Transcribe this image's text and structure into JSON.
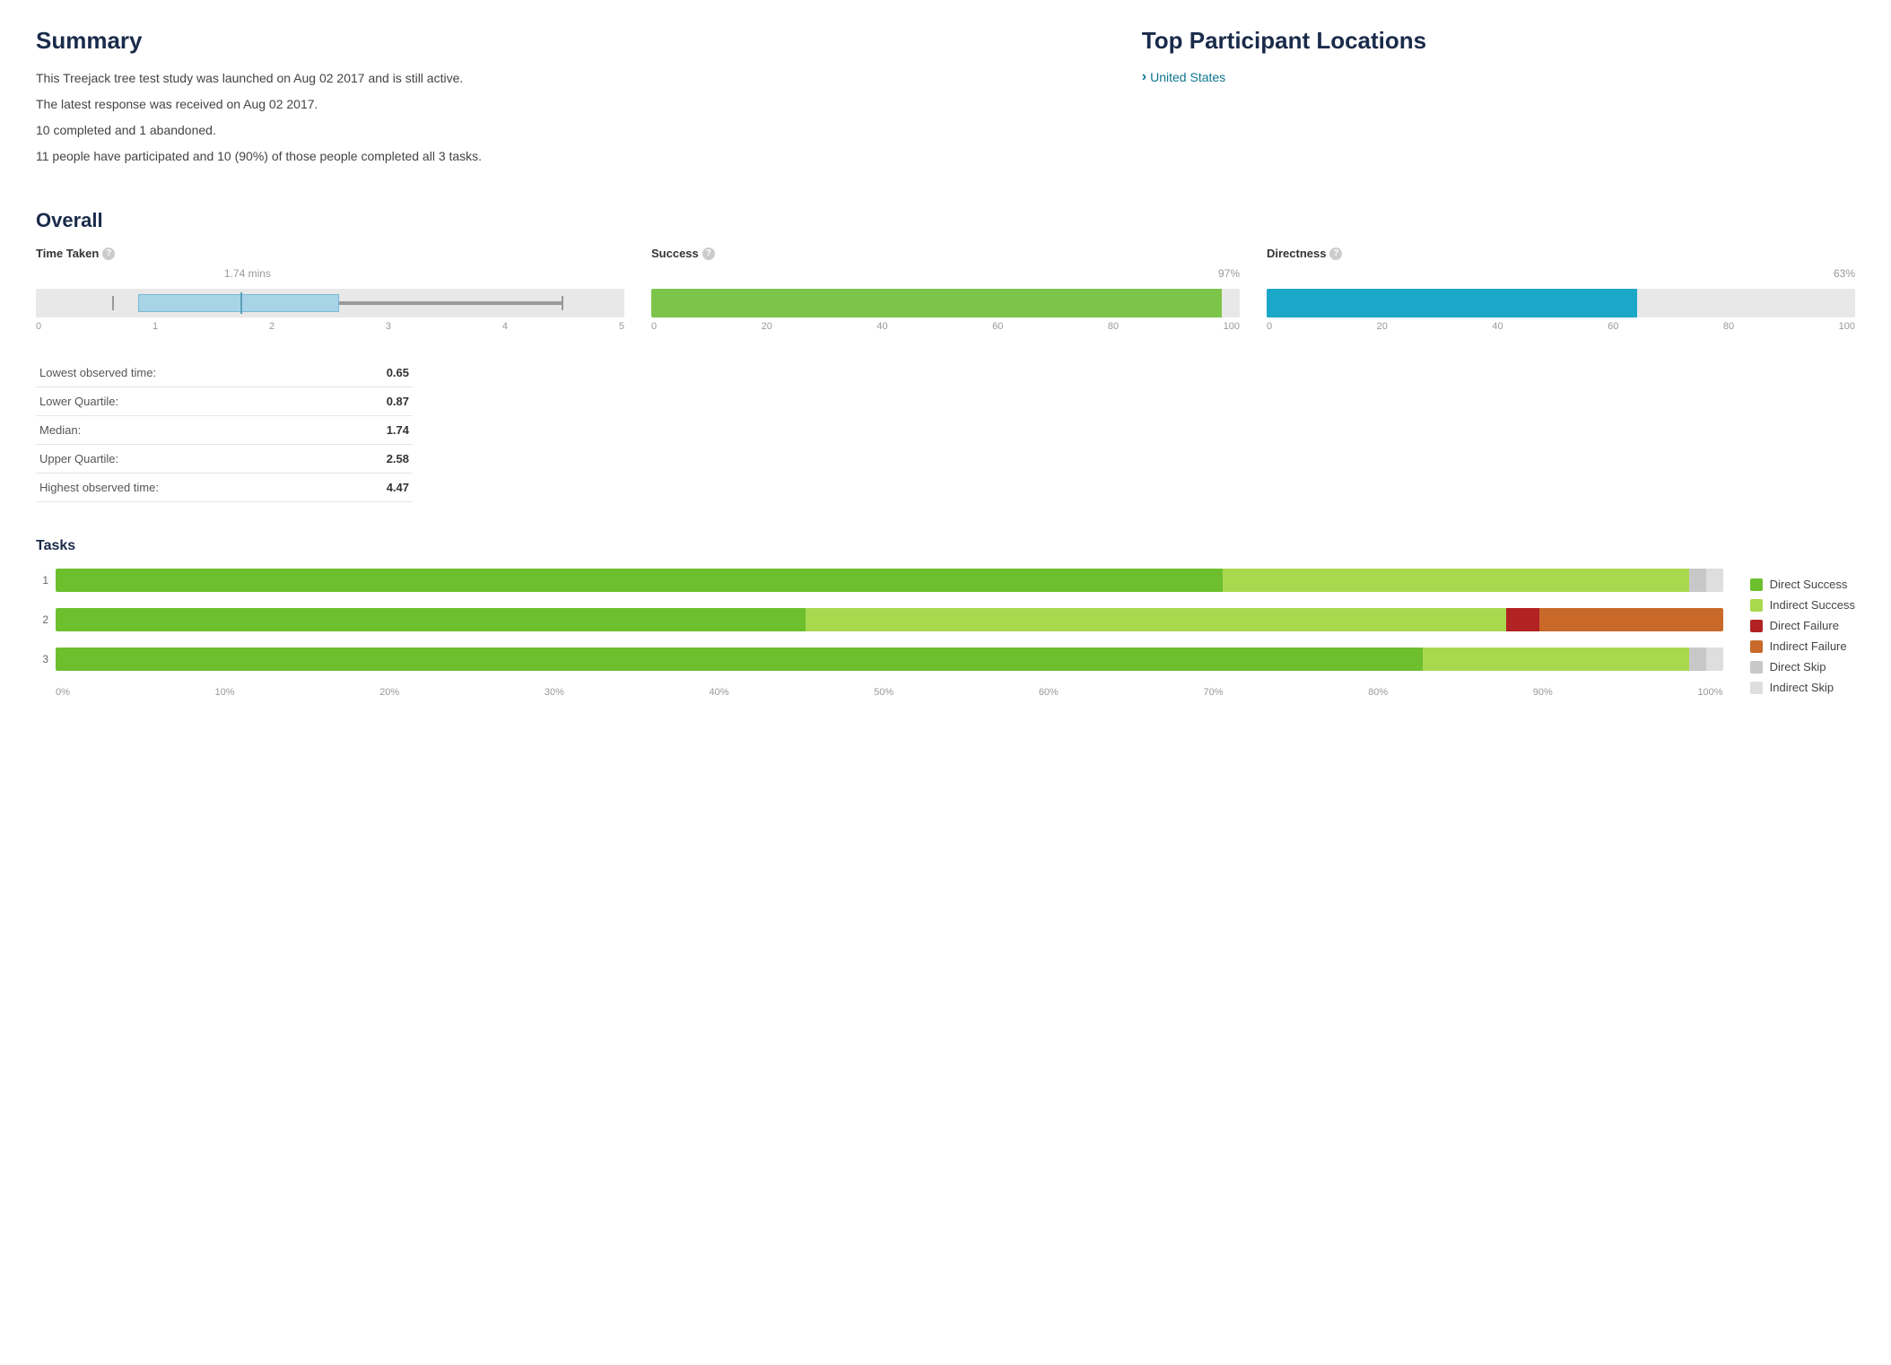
{
  "summary": {
    "title": "Summary",
    "lines": [
      "This Treejack tree test study was launched on Aug 02 2017 and is still active.",
      "The latest response was received on Aug 02 2017.",
      "10 completed and 1 abandoned.",
      "11 people have participated and 10 (90%) of those people completed all 3 tasks."
    ]
  },
  "locations": {
    "title": "Top Participant Locations",
    "items": [
      {
        "label": "United States"
      }
    ]
  },
  "overall": {
    "title": "Overall",
    "time_taken": {
      "label": "Time Taken",
      "value_label": "1.74 mins",
      "value_pct": 34.8,
      "q1_pct": 17.4,
      "median_pct": 34.8,
      "q3_pct": 51.6,
      "max_pct": 89.4,
      "axis": [
        "0",
        "1",
        "2",
        "3",
        "4",
        "5"
      ]
    },
    "success": {
      "label": "Success",
      "value_label": "97%",
      "bar_pct": 97,
      "axis": [
        "0",
        "20",
        "40",
        "60",
        "80",
        "100"
      ]
    },
    "directness": {
      "label": "Directness",
      "value_label": "63%",
      "bar_pct": 63,
      "axis": [
        "0",
        "20",
        "40",
        "60",
        "80",
        "100"
      ]
    },
    "stats": [
      {
        "label": "Lowest observed time:",
        "value": "0.65"
      },
      {
        "label": "Lower Quartile:",
        "value": "0.87"
      },
      {
        "label": "Median:",
        "value": "1.74"
      },
      {
        "label": "Upper Quartile:",
        "value": "2.58"
      },
      {
        "label": "Highest observed time:",
        "value": "4.47"
      }
    ]
  },
  "tasks": {
    "title": "Tasks",
    "rows": [
      {
        "number": "1",
        "segments": [
          {
            "color": "#6dbf2e",
            "pct": 70,
            "label": "Direct Success"
          },
          {
            "color": "#a8d84e",
            "pct": 28,
            "label": "Indirect Success"
          },
          {
            "color": "#c8c8c8",
            "pct": 1,
            "label": "Direct Skip"
          },
          {
            "color": "#dedede",
            "pct": 1,
            "label": "Indirect Skip"
          }
        ]
      },
      {
        "number": "2",
        "segments": [
          {
            "color": "#6dbf2e",
            "pct": 45,
            "label": "Direct Success"
          },
          {
            "color": "#a8d84e",
            "pct": 42,
            "label": "Indirect Success"
          },
          {
            "color": "#b22222",
            "pct": 2,
            "label": "Direct Failure"
          },
          {
            "color": "#c8692a",
            "pct": 11,
            "label": "Indirect Failure"
          }
        ]
      },
      {
        "number": "3",
        "segments": [
          {
            "color": "#6dbf2e",
            "pct": 82,
            "label": "Direct Success"
          },
          {
            "color": "#a8d84e",
            "pct": 16,
            "label": "Indirect Success"
          },
          {
            "color": "#c8c8c8",
            "pct": 1,
            "label": "Direct Skip"
          },
          {
            "color": "#dedede",
            "pct": 1,
            "label": "Indirect Skip"
          }
        ]
      }
    ],
    "axis": [
      "0%",
      "10%",
      "20%",
      "30%",
      "40%",
      "50%",
      "60%",
      "70%",
      "80%",
      "90%",
      "100%"
    ],
    "legend": [
      {
        "color": "#6dbf2e",
        "label": "Direct Success"
      },
      {
        "color": "#a8d84e",
        "label": "Indirect Success"
      },
      {
        "color": "#b22222",
        "label": "Direct Failure"
      },
      {
        "color": "#c8692a",
        "label": "Indirect Failure"
      },
      {
        "color": "#c8c8c8",
        "label": "Direct Skip"
      },
      {
        "color": "#dedede",
        "label": "Indirect Skip"
      }
    ]
  }
}
